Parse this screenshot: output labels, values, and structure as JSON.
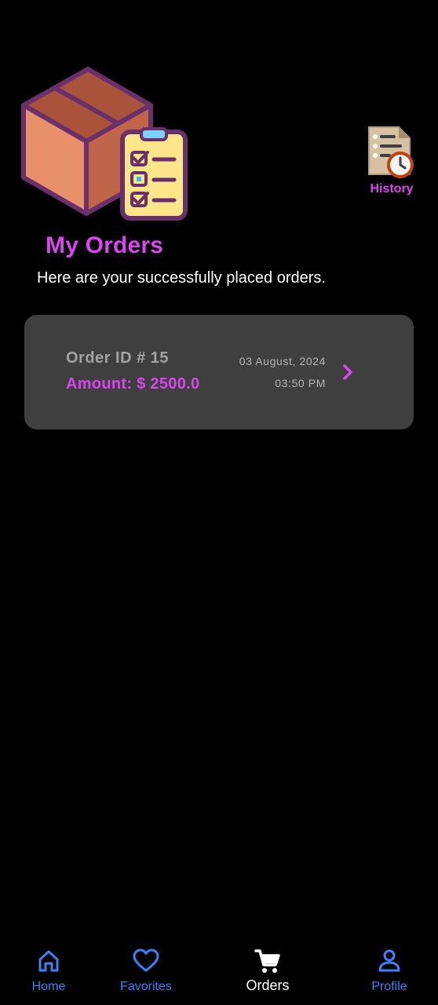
{
  "header": {
    "history_label": "History",
    "title": "My Orders",
    "subtitle": "Here are your successfully placed orders."
  },
  "orders": [
    {
      "id_label": "Order ID # 15",
      "amount_label": "Amount: $ 2500.0",
      "date": "03 August, 2024",
      "time": "03:50 PM"
    }
  ],
  "bottom_nav": {
    "items": [
      {
        "label": "Home",
        "icon": "home-icon",
        "active": false
      },
      {
        "label": "Favorites",
        "icon": "heart-icon",
        "active": false
      },
      {
        "label": "Orders",
        "icon": "cart-icon",
        "active": true
      },
      {
        "label": "Profile",
        "icon": "person-icon",
        "active": false
      }
    ]
  },
  "colors": {
    "accent": "#d946ef",
    "nav_inactive": "#3b82f6",
    "card_bg": "#3f3f3f",
    "background": "#000000"
  }
}
